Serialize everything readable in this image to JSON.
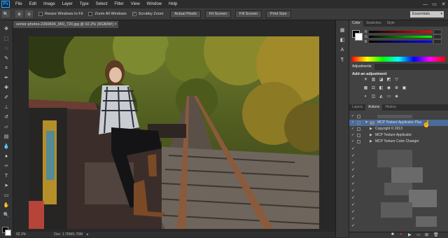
{
  "app": {
    "logo": "Ps"
  },
  "menu": [
    "File",
    "Edit",
    "Image",
    "Layer",
    "Type",
    "Select",
    "Filter",
    "View",
    "Window",
    "Help"
  ],
  "window_controls": [
    "—",
    "▭",
    "✕"
  ],
  "options_bar": {
    "resize_windows": "Resize Windows to Fit",
    "zoom_all": "Zoom All Windows",
    "scrubby_zoom": "Scrubby Zoom",
    "actual_pixels": "Actual Pixels",
    "fit_screen": "Fit Screen",
    "fill_screen": "Fill Screen",
    "print_size": "Print Size",
    "workspace": "Essentials",
    "zoom_all_checked": false,
    "scrubby_checked": true,
    "resize_checked": false
  },
  "document": {
    "tab_title": "senior-photos-2260604_960_720.jpg @ 92.2% (RGB/8#) ×",
    "zoom": "92.2%",
    "doc_info": "Doc: 1.76M/1.76M"
  },
  "panels": {
    "color_tabs": [
      "Color",
      "Swatches",
      "Style"
    ],
    "sliders": [
      "R",
      "G",
      "B"
    ],
    "adjustments_tab": "Adjustments",
    "adjustments_title": "Add an adjustment",
    "actions_tabs": [
      "Layers",
      "Actions",
      "History"
    ],
    "actions": [
      {
        "label": "",
        "indent": 0
      },
      {
        "label": "MCP Texture Applicator Plus",
        "indent": 1,
        "expanded": true,
        "selected": true
      },
      {
        "label": "Copyright © 2013",
        "indent": 2
      },
      {
        "label": "MCP Texture Applicator",
        "indent": 2
      },
      {
        "label": "MCP Texture Color Changer",
        "indent": 2
      }
    ]
  },
  "colors": {
    "accent": "#31a8ff",
    "selected_row": "#4b6b9a",
    "panel_bg": "#424242",
    "canvas_bg": "#282828"
  }
}
